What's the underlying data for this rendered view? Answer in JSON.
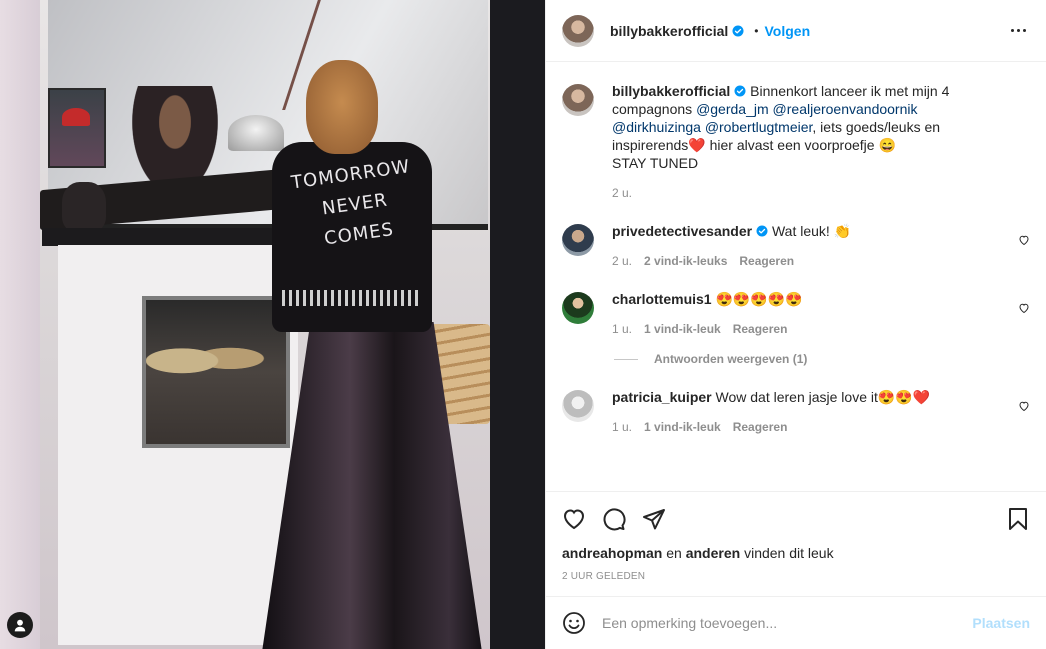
{
  "header": {
    "username": "billybakkerofficial",
    "separator": "•",
    "follow_label": "Volgen"
  },
  "photo": {
    "jacket_text_1": "TOMORROW",
    "jacket_text_2": "NEVER",
    "jacket_text_3": "COMES"
  },
  "caption": {
    "username": "billybakkerofficial",
    "text_1": "Binnenkort lanceer ik met mijn 4 compagnons",
    "mention_1": "@gerda_jm",
    "mention_2": "@realjeroenvandoornik",
    "mention_3": "@dirkhuizinga",
    "mention_4": "@robertlugtmeier",
    "text_2": ", iets goeds/leuks en inspirerends",
    "emoji_heart": "❤️",
    "text_3": " hier alvast een voorproefje",
    "emoji_grin": "😄",
    "text_4": "STAY TUNED",
    "time": "2 u."
  },
  "comments": [
    {
      "username": "privedetectivesander",
      "text": "Wat leuk!",
      "emoji": "👏",
      "time": "2 u.",
      "likes": "2 vind-ik-leuks",
      "reply": "Reageren"
    },
    {
      "username": "charlottemuis1",
      "text": "",
      "emoji": "😍😍😍😍😍",
      "time": "1 u.",
      "likes": "1 vind-ik-leuk",
      "reply": "Reageren",
      "replies_label": "Antwoorden weergeven (1)"
    },
    {
      "username": "patricia_kuiper",
      "text": "Wow dat leren jasje love it",
      "emoji": "😍😍❤️",
      "time": "1 u.",
      "likes": "1 vind-ik-leuk",
      "reply": "Reageren"
    }
  ],
  "likes": {
    "user": "andreahopman",
    "connector": "en",
    "others": "anderen",
    "suffix": "vinden dit leuk"
  },
  "timestamp": "2 UUR GELEDEN",
  "add_comment": {
    "placeholder": "Een opmerking toevoegen...",
    "post_label": "Plaatsen"
  },
  "colors": {
    "accent": "#0095f6",
    "verified": "#0095f6",
    "mention": "#00376b",
    "heart": "#ed4956",
    "post_disabled": "#b2dffc"
  }
}
